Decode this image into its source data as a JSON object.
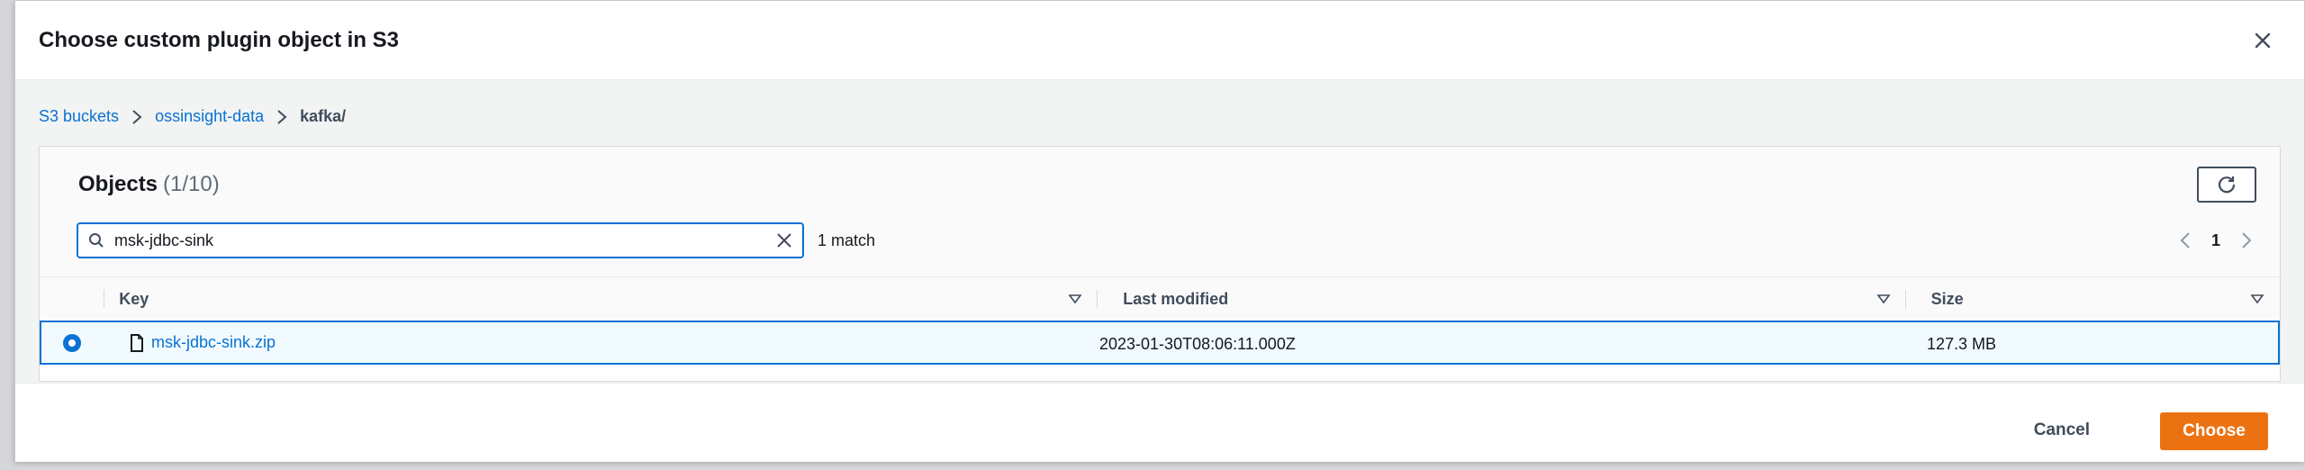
{
  "modal": {
    "title": "Choose custom plugin object in S3"
  },
  "breadcrumb": {
    "items": [
      "S3 buckets",
      "ossinsight-data"
    ],
    "current": "kafka/"
  },
  "objects": {
    "title": "Objects",
    "count": "(1/10)",
    "search_value": "msk-jdbc-sink",
    "match_text": "1 match",
    "page": "1"
  },
  "table": {
    "columns": [
      "Key",
      "Last modified",
      "Size"
    ],
    "rows": [
      {
        "key": "msk-jdbc-sink.zip",
        "last_modified": "2023-01-30T08:06:11.000Z",
        "size": "127.3 MB",
        "selected": true
      }
    ]
  },
  "footer": {
    "cancel_label": "Cancel",
    "choose_label": "Choose"
  },
  "colors": {
    "link": "#0972d3",
    "primary_button": "#ec7211",
    "selected_row_bg": "#f1faff"
  },
  "icons": [
    "close-icon",
    "chevron-right-icon",
    "refresh-icon",
    "search-icon",
    "clear-icon",
    "chevron-left-icon",
    "sort-icon",
    "file-icon",
    "radio-selected-icon"
  ]
}
